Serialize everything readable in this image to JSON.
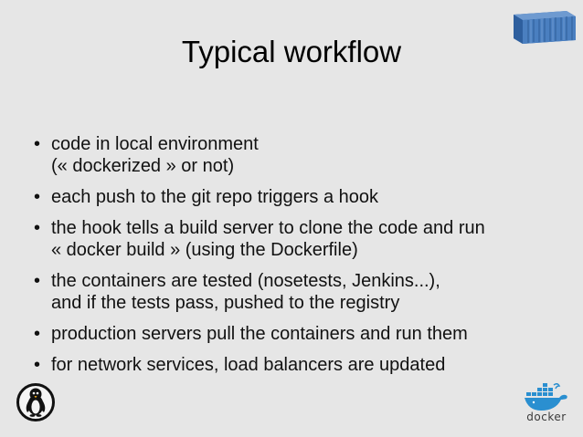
{
  "slide": {
    "title": "Typical workflow",
    "bullets": [
      {
        "lines": [
          "code in local environment",
          "(« dockerized » or not)"
        ]
      },
      {
        "lines": [
          "each push to the git repo triggers a hook"
        ]
      },
      {
        "lines": [
          "the hook tells a build server to clone the code and run",
          "« docker build » (using the Dockerfile)"
        ]
      },
      {
        "lines": [
          "the containers are tested (nosetests, Jenkins...),",
          "and if the tests pass, pushed to the registry"
        ]
      },
      {
        "lines": [
          "production servers pull the containers and run them"
        ]
      },
      {
        "lines": [
          "for network services, load balancers are updated"
        ]
      }
    ],
    "bullet_symbol": "•",
    "logo": {
      "text": "docker"
    }
  },
  "icons": {
    "top_right": "shipping-container-icon",
    "bottom_left": "penguin-badge-icon",
    "bottom_right": "docker-whale-logo"
  },
  "colors": {
    "background": "#e6e6e6",
    "text": "#111111",
    "container_blue": "#4a7fc0",
    "docker_blue": "#2a8fd0"
  }
}
